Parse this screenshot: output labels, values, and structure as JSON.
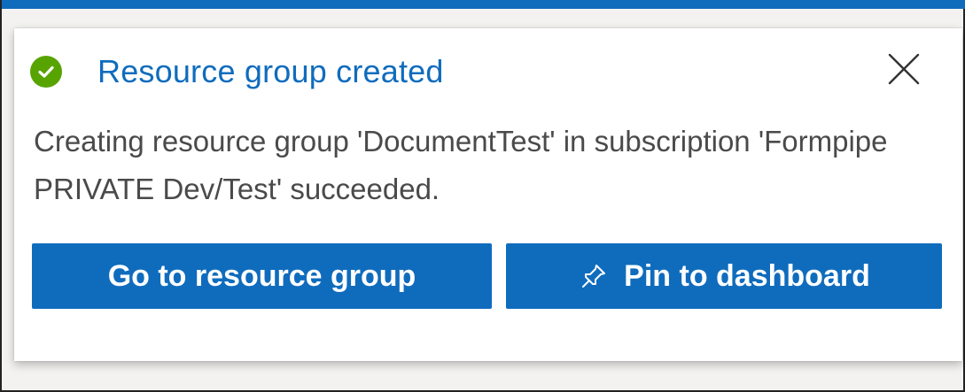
{
  "notification": {
    "status": "success",
    "title": "Resource group created",
    "message": "Creating resource group 'DocumentTest' in subscription 'Formpipe PRIVATE Dev/Test' succeeded.",
    "close_icon": "close-icon",
    "status_icon": "checkmark-circle-icon"
  },
  "actions": {
    "go_label": "Go to resource group",
    "pin_label": "Pin to dashboard",
    "pin_icon": "pin-icon"
  },
  "colors": {
    "accent": "#0f6cbd",
    "success": "#57a300",
    "body_text": "#4a4a4a",
    "button_text": "#ffffff"
  }
}
